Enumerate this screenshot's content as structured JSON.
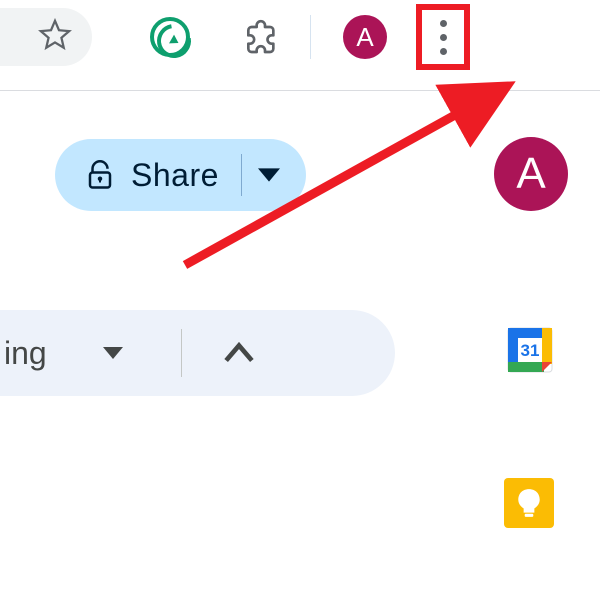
{
  "browser": {
    "avatar_initial": "A"
  },
  "share": {
    "label": "Share"
  },
  "doc": {
    "avatar_initial": "A"
  },
  "toolbar": {
    "mode_fragment": "ing"
  },
  "calendar": {
    "day": "31"
  },
  "annotation": {
    "highlight_color": "#ed1c24",
    "target": "chrome-menu"
  }
}
